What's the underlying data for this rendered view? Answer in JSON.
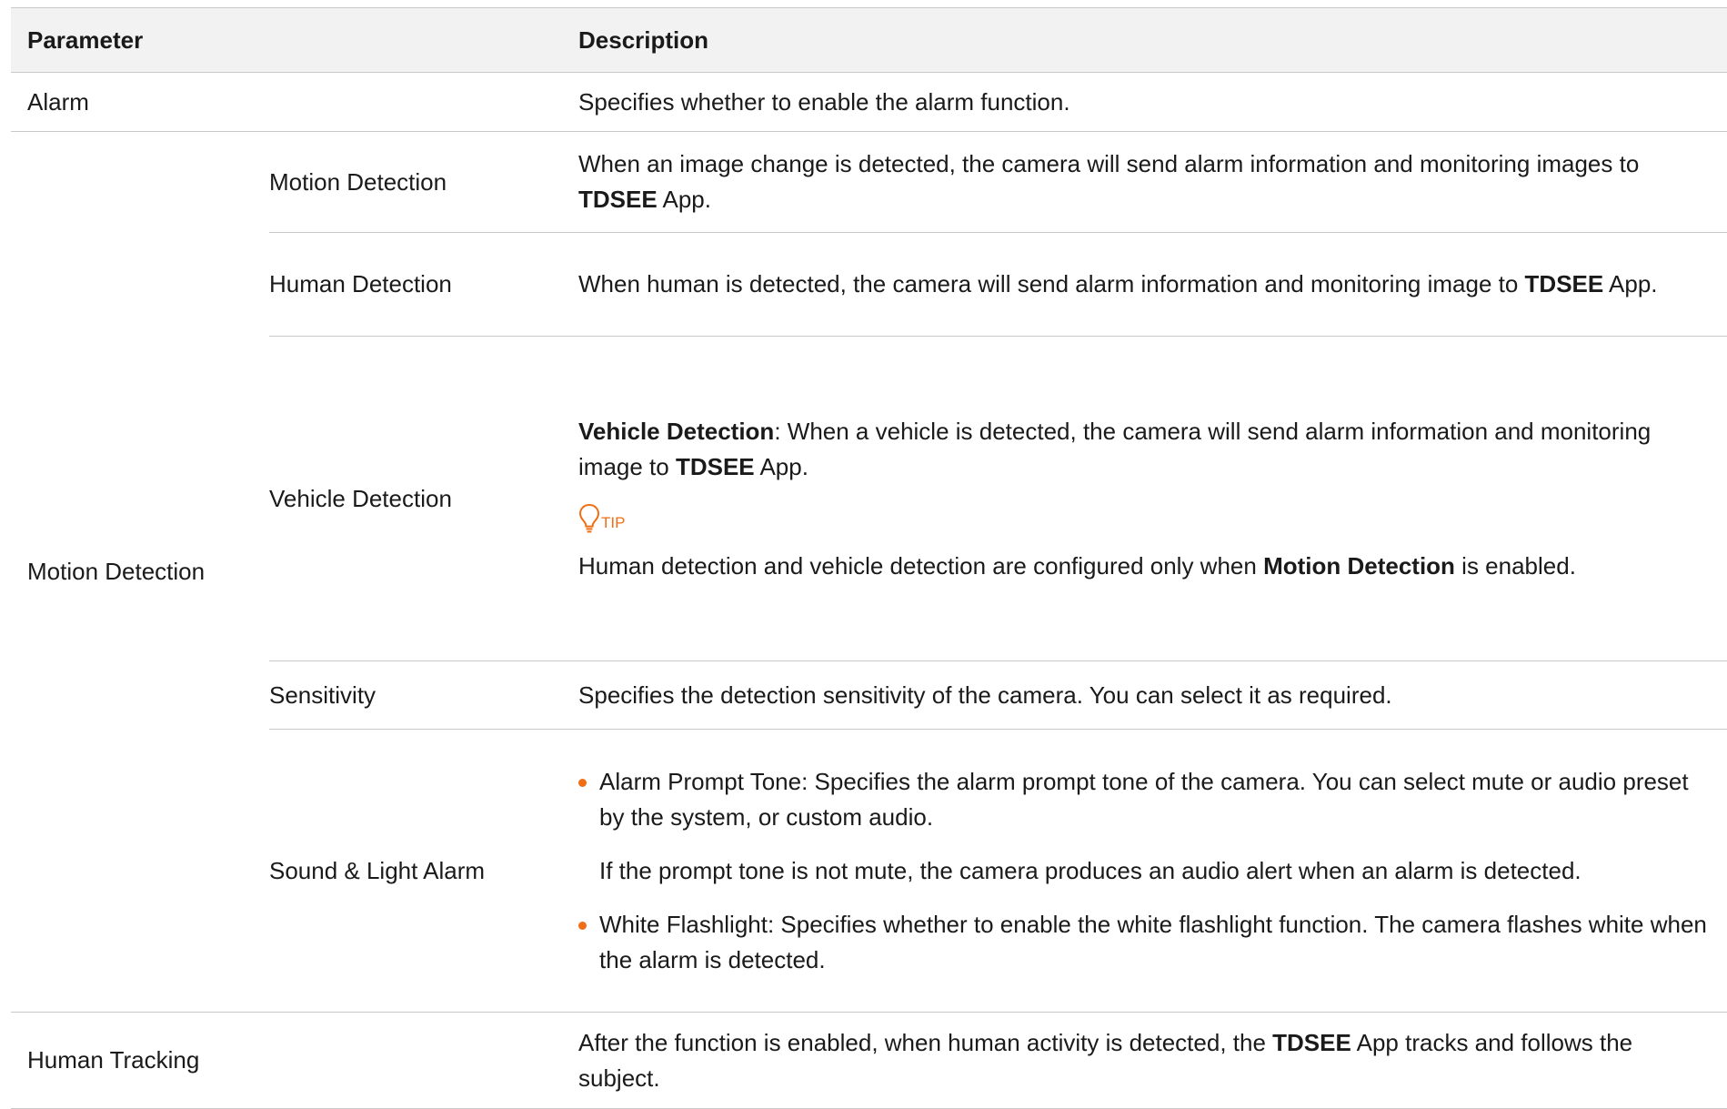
{
  "table": {
    "headers": {
      "parameter": "Parameter",
      "description": "Description"
    },
    "alarm": {
      "name": "Alarm",
      "description": "Specifies whether to enable the alarm function."
    },
    "motion_detection": {
      "name": "Motion Detection",
      "motion": {
        "name": "Motion Detection",
        "desc_pre": "When an image change is detected, the camera will send alarm information and monitoring images to ",
        "desc_bold": "TDSEE",
        "desc_post": " App."
      },
      "human": {
        "name": "Human Detection",
        "desc_pre": "When human is detected, the camera will send alarm information and monitoring image to ",
        "desc_bold": "TDSEE",
        "desc_post": " App."
      },
      "vehicle": {
        "name": "Vehicle Detection",
        "p1_bold": "Vehicle Detection",
        "p1_mid": ": When a vehicle is detected, the camera will send alarm information and monitoring image to ",
        "p1_bold2": "TDSEE",
        "p1_post": " App.",
        "tip_label": "TIP",
        "tip_pre": "Human detection and vehicle detection are configured only when ",
        "tip_bold": "Motion Detection",
        "tip_post": " is enabled."
      },
      "sensitivity": {
        "name": "Sensitivity",
        "description": "Specifies the detection sensitivity of the camera. You can select it as required."
      },
      "sound_light": {
        "name": "Sound & Light Alarm",
        "bullet1": "Alarm Prompt Tone: Specifies the alarm prompt tone of the camera. You can select mute or audio preset by the system, or custom audio.",
        "bullet1_note": "If the prompt tone is not mute, the camera produces an audio alert when an alarm is detected.",
        "bullet2": "White Flashlight: Specifies whether to enable the white flashlight function. The camera flashes white when the alarm is detected."
      }
    },
    "human_tracking": {
      "name": "Human Tracking",
      "desc_pre": "After the function is enabled, when human activity is detected, the ",
      "desc_bold": "TDSEE",
      "desc_post": " App tracks and follows the subject."
    }
  },
  "colors": {
    "accent": "#f06e14",
    "header_bg": "#f2f2f2",
    "rule": "#c9c9c9"
  },
  "icons": {
    "tip": "lightbulb-icon"
  }
}
